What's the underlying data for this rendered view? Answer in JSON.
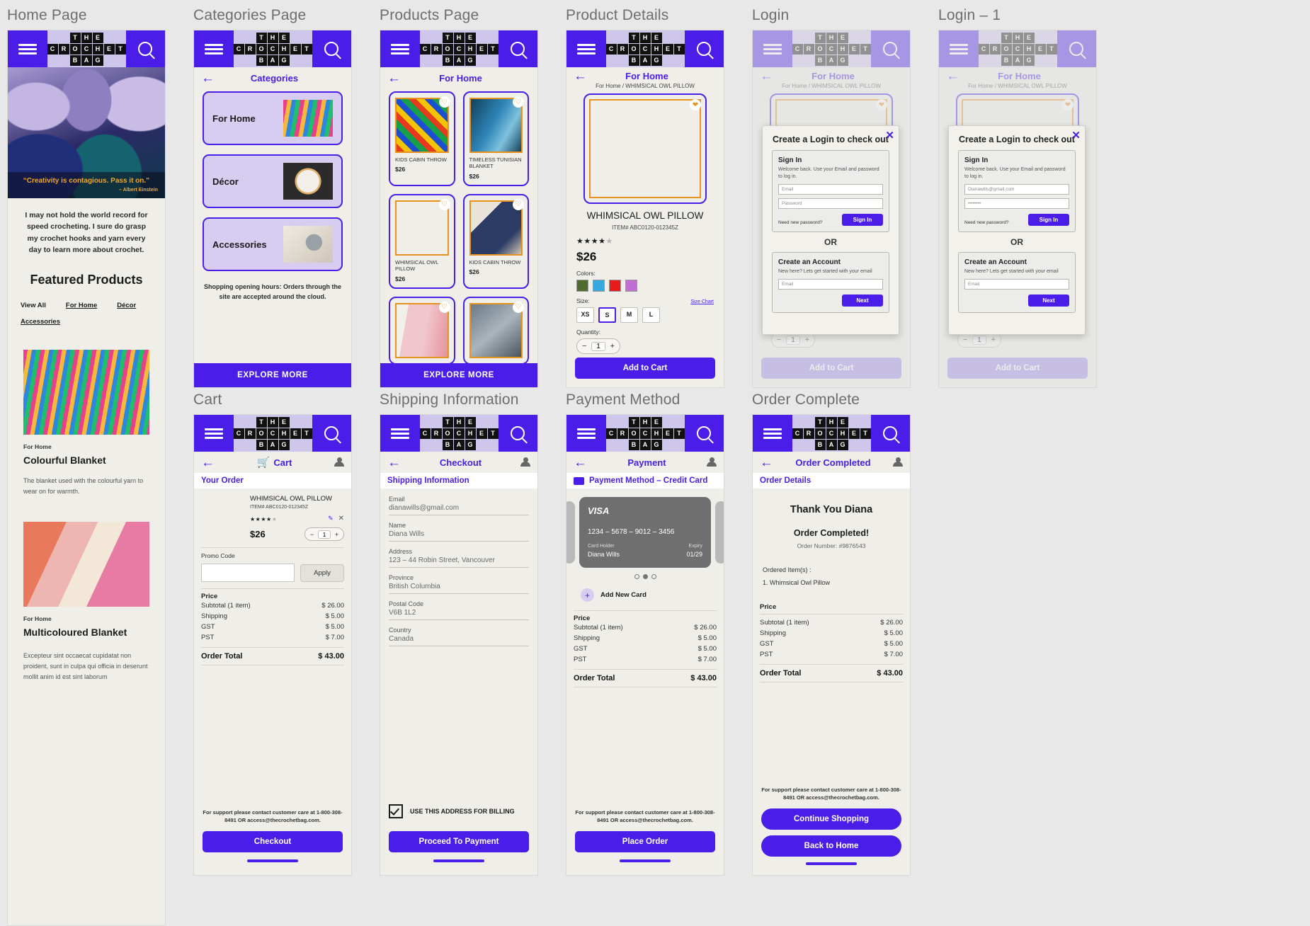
{
  "brand": {
    "logo_rows": [
      [
        "T",
        "H",
        "E"
      ],
      [
        "C",
        "R",
        "O",
        "C",
        "H",
        "E",
        "T"
      ],
      [
        "B",
        "A",
        "G"
      ]
    ],
    "accent": "#4a1ee8",
    "orange": "#e8921e",
    "bar_bg": "#cfc6ec"
  },
  "screens": {
    "home": {
      "label": "Home Page",
      "quote": "“Creativity is contagious. Pass it on.”",
      "quote_author": "– Albert Einstein",
      "intro": "I may not hold the world record for speed crocheting. I sure do grasp my crochet hooks and yarn every day to learn more about crochet.",
      "featured_title": "Featured Products",
      "filters": [
        "View All",
        "For Home",
        "Décor",
        "Accessories"
      ],
      "products": [
        {
          "category": "For Home",
          "name": "Colourful Blanket",
          "desc": "The blanket used with the colourful yarn to wear on for warmth."
        },
        {
          "category": "For Home",
          "name": "Multicoloured Blanket",
          "desc": "Excepteur sint occaecat cupidatat non proident, sunt in culpa qui officia in deserunt mollit anim id est sint laborum"
        }
      ]
    },
    "categories": {
      "label": "Categories Page",
      "title": "Categories",
      "items": [
        "For Home",
        "Décor",
        "Accessories"
      ],
      "note": "Shopping opening hours: Orders through the site are accepted around the cloud.",
      "cta": "EXPLORE MORE"
    },
    "products": {
      "label": "Products Page",
      "title": "For Home",
      "cta": "EXPLORE MORE",
      "items": [
        {
          "name": "KIDS CABIN THROW",
          "price": "$26"
        },
        {
          "name": "TIMELESS TUNISIAN BLANKET",
          "price": "$26"
        },
        {
          "name": "WHIMSICAL OWL PILLOW",
          "price": "$26"
        },
        {
          "name": "KIDS CABIN THROW",
          "price": "$26"
        },
        {
          "name": "",
          "price": ""
        },
        {
          "name": "",
          "price": ""
        }
      ]
    },
    "details": {
      "label": "Product Details",
      "title": "For Home",
      "breadcrumb": "For Home / WHIMSICAL OWL PILLOW",
      "name": "WHIMSICAL OWL PILLOW",
      "item_no": "ITEM# ABC0120-012345Z",
      "rating": 4,
      "rating_max": 5,
      "price": "$26",
      "colors_label": "Colors:",
      "colors": [
        "#4f6b2e",
        "#35a8dd",
        "#e81b1b",
        "#bf6fd0"
      ],
      "size_label": "Size:",
      "size_chart": "Size Chart",
      "sizes": [
        "XS",
        "S",
        "M",
        "L"
      ],
      "selected_size": "S",
      "qty_label": "Quantity:",
      "qty": "1",
      "add_to_cart": "Add to Cart"
    },
    "login": {
      "label": "Login",
      "title": "Create a Login to check out",
      "sign_in": {
        "heading": "Sign In",
        "sub": "Welcome back. Use your Email and password to log in.",
        "email_placeholder": "Email",
        "password_placeholder": "Password",
        "need_password": "Need new password?",
        "button": "Sign In"
      },
      "or": "OR",
      "create": {
        "heading": "Create an Account",
        "sub": "New here? Lets get started with your email",
        "email_placeholder": "Email",
        "button": "Next"
      },
      "add_to_cart": "Add to Cart",
      "qty": "1"
    },
    "login1": {
      "label": "Login – 1",
      "title": "Create a Login to check out",
      "sign_in": {
        "heading": "Sign In",
        "sub": "Welcome back. Use your Email and password to log in.",
        "email_value": "Dianawills@gmail.com",
        "password_value": "••••••••",
        "need_password": "Need new password?",
        "button": "Sign In"
      },
      "or": "OR",
      "create": {
        "heading": "Create an Account",
        "sub": "New here? Lets get started with your email",
        "email_placeholder": "Email",
        "button": "Next"
      },
      "add_to_cart": "Add to Cart",
      "qty": "1"
    },
    "cart": {
      "label": "Cart",
      "title": "Cart",
      "section": "Your Order",
      "item": {
        "name": "WHIMSICAL OWL PILLOW",
        "item_no": "ITEM# ABC0120-012345Z",
        "rating": 4,
        "price": "$26",
        "qty": "1"
      },
      "promo_label": "Promo Code",
      "promo_value": "",
      "apply": "Apply",
      "price_header": "Price",
      "rows": [
        {
          "label": "Subtotal (1 item)",
          "value": "$ 26.00"
        },
        {
          "label": "Shipping",
          "value": "$ 5.00"
        },
        {
          "label": "GST",
          "value": "$ 5.00"
        },
        {
          "label": "PST",
          "value": "$ 7.00"
        }
      ],
      "total_label": "Order Total",
      "total_value": "$ 43.00",
      "support": "For support please contact customer care at 1-800-308-8491 OR access@thecrochetbag.com.",
      "cta": "Checkout"
    },
    "shipping": {
      "label": "Shipping Information",
      "title": "Checkout",
      "section": "Shipping Information",
      "fields": [
        {
          "label": "Email",
          "value": "dianawills@gmail.com"
        },
        {
          "label": "Name",
          "value": "Diana Wills"
        },
        {
          "label": "Address",
          "value": "123 – 44 Robin Street, Vancouver"
        },
        {
          "label": "Province",
          "value": "British Columbia"
        },
        {
          "label": "Postal Code",
          "value": "V6B 1L2"
        },
        {
          "label": "Country",
          "value": "Canada"
        }
      ],
      "billing_checkbox": "USE THIS ADDRESS FOR BILLING",
      "cta": "Proceed To Payment"
    },
    "payment": {
      "label": "Payment Method",
      "title": "Payment",
      "section": "Payment Method – Credit Card",
      "card": {
        "brand": "VISA",
        "number": "1234 – 5678 – 9012 – 3456",
        "holder_label": "Card Holder",
        "holder": "Diana Wills",
        "expiry_label": "Expiry",
        "expiry": "01/29"
      },
      "add_card": "Add New Card",
      "price_header": "Price",
      "rows": [
        {
          "label": "Subtotal (1 item)",
          "value": "$ 26.00"
        },
        {
          "label": "Shipping",
          "value": "$ 5.00"
        },
        {
          "label": "GST",
          "value": "$ 5.00"
        },
        {
          "label": "PST",
          "value": "$ 7.00"
        }
      ],
      "total_label": "Order Total",
      "total_value": "$ 43.00",
      "support": "For support please contact customer care at 1-800-308-8491 OR access@thecrochetbag.com.",
      "cta": "Place Order"
    },
    "complete": {
      "label": "Order Complete",
      "title": "Order Completed",
      "section": "Order Details",
      "thanks": "Thank You Diana",
      "completed": "Order Completed!",
      "order_number": "Order Number: #9876543",
      "ordered_label": "Ordered Item(s) :",
      "ordered_items": [
        "1. Whimsical Owl Pillow"
      ],
      "price_header": "Price",
      "rows": [
        {
          "label": "Subtotal (1 item)",
          "value": "$ 26.00"
        },
        {
          "label": "Shipping",
          "value": "$ 5.00"
        },
        {
          "label": "GST",
          "value": "$ 5.00"
        },
        {
          "label": "PST",
          "value": "$ 7.00"
        }
      ],
      "total_label": "Order Total",
      "total_value": "$ 43.00",
      "support": "For support please contact customer care at 1-800-308-8491 OR access@thecrochetbag.com.",
      "cta_primary": "Continue Shopping",
      "cta_secondary": "Back to Home"
    }
  }
}
